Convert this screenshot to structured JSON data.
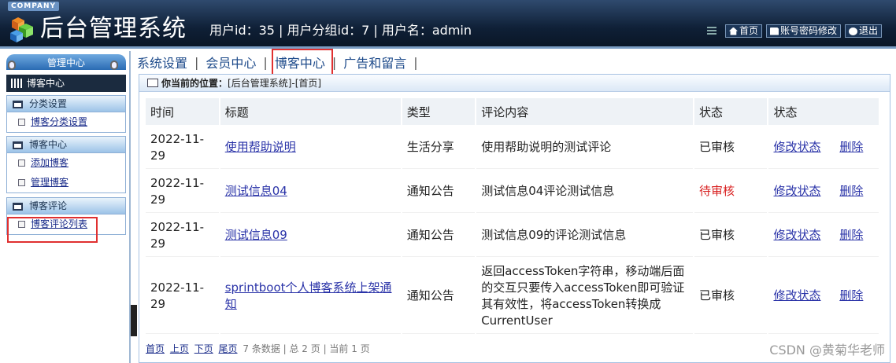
{
  "header": {
    "company": "COMPANY",
    "title": "后台管理系统",
    "user_info": "用户id：35 | 用户分组id：7 | 用户名：admin",
    "links": [
      {
        "icon": "home-icon",
        "label": "首页"
      },
      {
        "icon": "document-icon",
        "label": "账号密码修改"
      },
      {
        "icon": "power-icon",
        "label": "退出"
      }
    ]
  },
  "sidebar": {
    "mgmt_title": "管理中心",
    "active_section": "博客中心",
    "groups": [
      {
        "title": "分类设置",
        "items": [
          "博客分类设置"
        ]
      },
      {
        "title": "博客中心",
        "items": [
          "添加博客",
          "管理博客"
        ]
      },
      {
        "title": "博客评论",
        "items": [
          "博客评论列表"
        ]
      }
    ]
  },
  "nav": {
    "tabs": [
      "系统设置",
      "会员中心",
      "博客中心",
      "广告和留言"
    ],
    "separator": "|"
  },
  "location": {
    "prefix": "你当前的位置：",
    "path": "[后台管理系统]-[首页]"
  },
  "table": {
    "headers": [
      "时间",
      "标题",
      "类型",
      "评论内容",
      "状态",
      "状态"
    ],
    "rows": [
      {
        "time": "2022-11-29",
        "title": "使用帮助说明",
        "type": "生活分享",
        "comment": "使用帮助说明的测试评论",
        "status": "已审核",
        "edit": "修改状态",
        "delete": "删除"
      },
      {
        "time": "2022-11-29",
        "title": "测试信息04",
        "type": "通知公告",
        "comment": "测试信息04评论测试信息",
        "status": "待审核",
        "edit": "修改状态",
        "delete": "删除"
      },
      {
        "time": "2022-11-29",
        "title": "测试信息09",
        "type": "通知公告",
        "comment": "测试信息09的评论测试信息",
        "status": "已审核",
        "edit": "修改状态",
        "delete": "删除"
      },
      {
        "time": "2022-11-29",
        "title": "sprintboot个人博客系统上架通知",
        "type": "通知公告",
        "comment": "返回accessToken字符串，移动端后面的交互只要传入accessToken即可验证其有效性，将accessToken转换成CurrentUser",
        "status": "已审核",
        "edit": "修改状态",
        "delete": "删除"
      }
    ]
  },
  "pager": {
    "first": "首页",
    "prev": "上页",
    "next": "下页",
    "last": "尾页",
    "summary": "7 条数据 | 总 2 页 | 当前 1 页"
  },
  "watermark": "CSDN @黄菊华老师",
  "colors": {
    "pending": "#d82020",
    "highlight_box": "#e03030"
  }
}
